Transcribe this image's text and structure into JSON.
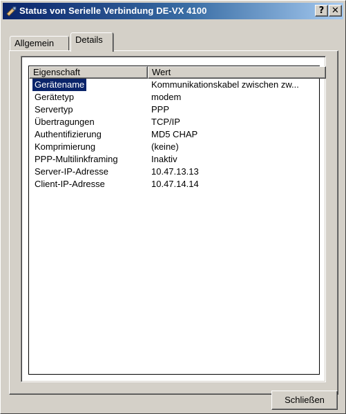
{
  "window": {
    "title": "Status von Serielle Verbindung DE-VX 4100",
    "help_label": "?",
    "close_label": "✕"
  },
  "tabs": [
    {
      "label": "Allgemein",
      "active": false
    },
    {
      "label": "Details",
      "active": true
    }
  ],
  "listview": {
    "columns": [
      "Eigenschaft",
      "Wert"
    ],
    "rows": [
      {
        "property": "Gerätename",
        "value": "Kommunikationskabel zwischen zw..."
      },
      {
        "property": "Gerätetyp",
        "value": "modem"
      },
      {
        "property": "Servertyp",
        "value": "PPP"
      },
      {
        "property": "Übertragungen",
        "value": "TCP/IP"
      },
      {
        "property": "Authentifizierung",
        "value": "MD5 CHAP"
      },
      {
        "property": "Komprimierung",
        "value": "(keine)"
      },
      {
        "property": "PPP-Multilinkframing",
        "value": "Inaktiv"
      },
      {
        "property": "Server-IP-Adresse",
        "value": "10.47.13.13"
      },
      {
        "property": "Client-IP-Adresse",
        "value": "10.47.14.14"
      }
    ],
    "selected_index": 0
  },
  "buttons": {
    "close_label": "Schließen"
  },
  "colors": {
    "titlebar_start": "#0a246a",
    "titlebar_end": "#a6caf0",
    "face": "#d4d0c8",
    "selection": "#0a246a"
  }
}
